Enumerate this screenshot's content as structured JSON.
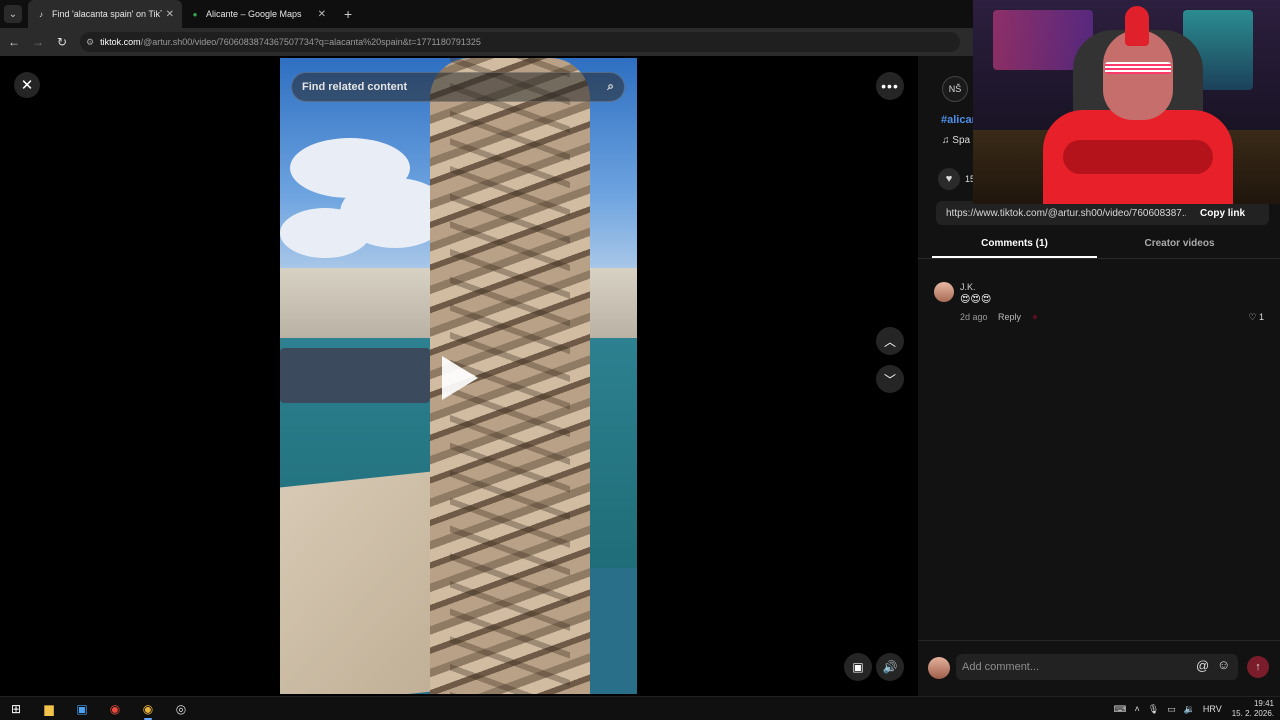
{
  "browser": {
    "tabs": [
      {
        "title": "Find 'alacanta spain' on TikTok",
        "favicon": "tiktok-icon",
        "active": true
      },
      {
        "title": "Alicante – Google Maps",
        "favicon": "maps-pin-icon",
        "active": false
      }
    ],
    "address": {
      "domain": "tiktok.com",
      "path": "/@artur.sh00/video/7606083874367507734?q=alacanta%20spain&t=1771180791325"
    }
  },
  "viewer": {
    "search_placeholder": "Find related content",
    "close_icon": "✕",
    "more_icon": "•••"
  },
  "panel": {
    "author_avatar_text": "NŠ",
    "hashtag": "#alicar",
    "music": "♫  Spa",
    "likes": "15",
    "link_url": "https://www.tiktok.com/@artur.sh00/video/760608387...",
    "copy_link": "Copy link",
    "tabs": [
      {
        "label": "Comments (1)",
        "active": true
      },
      {
        "label": "Creator videos",
        "active": false
      }
    ],
    "comments": [
      {
        "name": "J.K.",
        "text": "😍😍😍",
        "time": "2d ago",
        "reply": "Reply",
        "likes": "1"
      }
    ],
    "add_comment_placeholder": "Add comment..."
  },
  "taskbar": {
    "language": "HRV",
    "time": "19:41",
    "date": "15. 2. 2026."
  },
  "colors": {
    "accent_red": "#fe2c55",
    "hashtag_blue": "#4e8ee8"
  }
}
